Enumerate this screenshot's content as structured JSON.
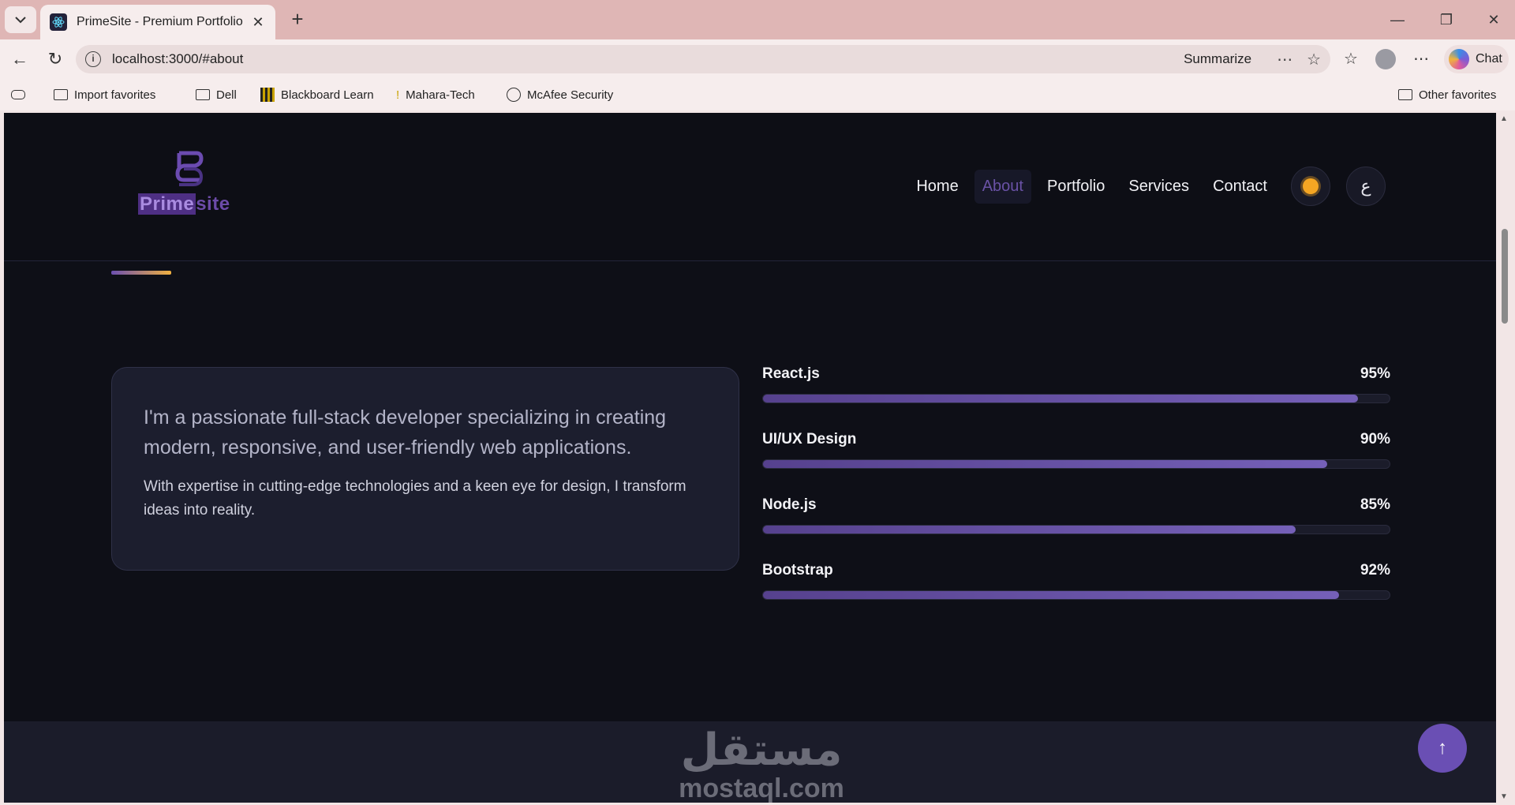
{
  "browser": {
    "tab_title": "PrimeSite - Premium Portfolio",
    "url": "localhost:3000/#about",
    "summarize_label": "Summarize",
    "chat_label": "Chat",
    "bookmarks": [
      {
        "label": "Import favorites",
        "icon": "import-icon"
      },
      {
        "label": "Dell",
        "icon": "folder-icon"
      },
      {
        "label": "Blackboard Learn",
        "icon": "blackboard-icon"
      },
      {
        "label": "Mahara-Tech",
        "icon": "torch-icon"
      },
      {
        "label": "McAfee Security",
        "icon": "globe-icon"
      }
    ],
    "other_favorites": "Other favorites"
  },
  "site": {
    "logo": {
      "part1": "Prime",
      "part2": "site"
    },
    "nav": [
      {
        "label": "Home",
        "active": false
      },
      {
        "label": "About",
        "active": true
      },
      {
        "label": "Portfolio",
        "active": false
      },
      {
        "label": "Services",
        "active": false
      },
      {
        "label": "Contact",
        "active": false
      }
    ],
    "lang_toggle": "ع",
    "theme_icon": "sun-icon",
    "about": {
      "lead": "I'm a passionate full-stack developer specializing in creating modern, responsive, and user-friendly web applications.",
      "desc": "With expertise in cutting-edge technologies and a keen eye for design, I transform ideas into reality."
    },
    "skills": [
      {
        "name": "React.js",
        "percent": "95%",
        "value": 95
      },
      {
        "name": "UI/UX Design",
        "percent": "90%",
        "value": 90
      },
      {
        "name": "Node.js",
        "percent": "85%",
        "value": 85
      },
      {
        "name": "Bootstrap",
        "percent": "92%",
        "value": 92
      }
    ],
    "watermark": {
      "arabic": "مستقل",
      "latin": "mostaql.com"
    },
    "back_to_top": "↑"
  },
  "colors": {
    "accent": "#6a4fb4",
    "background": "#0e0f17",
    "card": "#1c1e2e",
    "sun": "#f5a623"
  }
}
